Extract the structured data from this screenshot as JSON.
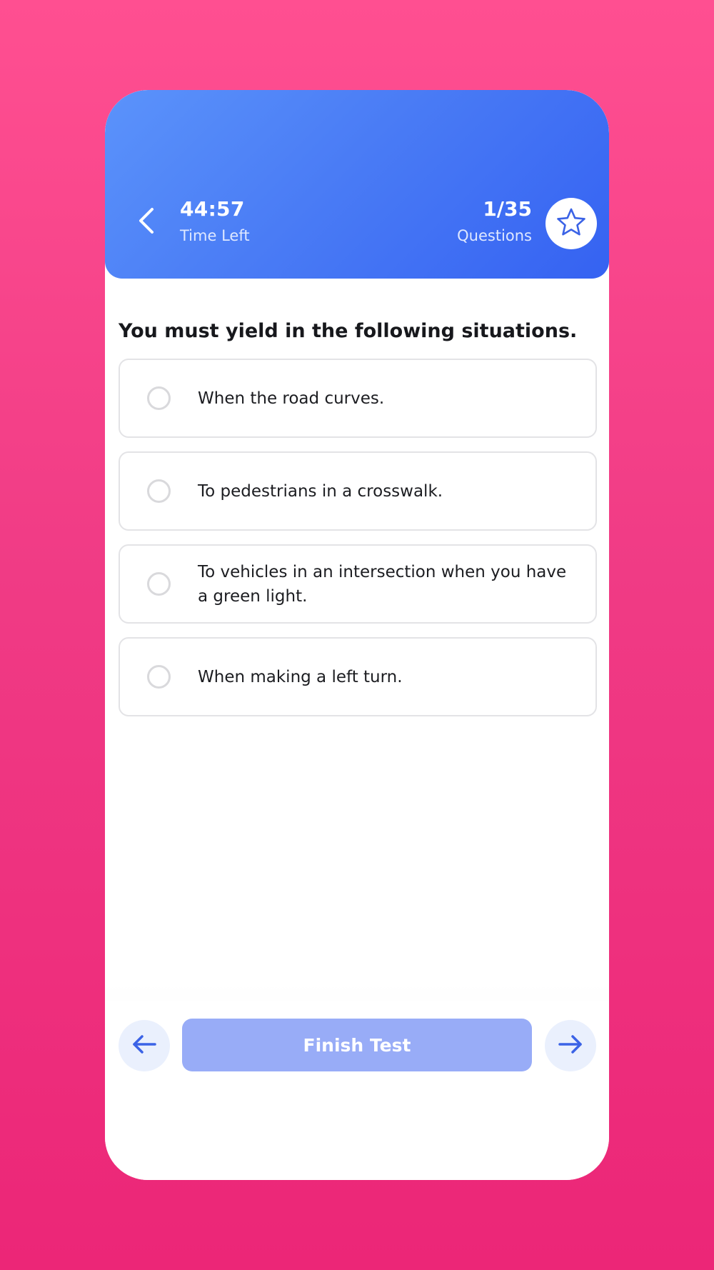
{
  "header": {
    "timer_value": "44:57",
    "timer_label": "Time Left",
    "progress_value": "1/35",
    "progress_label": "Questions"
  },
  "question": {
    "text": "You must yield in the following situations."
  },
  "options": [
    {
      "label": "When the road curves."
    },
    {
      "label": "To pedestrians in a crosswalk."
    },
    {
      "label": "To vehicles in an intersection when you have a green light."
    },
    {
      "label": "When making a left turn."
    }
  ],
  "footer": {
    "finish_label": "Finish Test"
  },
  "icons": {
    "back": "chevron-left-icon",
    "star": "star-icon",
    "prev": "arrow-left-icon",
    "next": "arrow-right-icon"
  },
  "colors": {
    "background": "#f03b85",
    "header_start": "#5b93fb",
    "header_end": "#3562f2",
    "finish_button": "#98acf7",
    "nav_button": "#eaf0fd",
    "accent_icon": "#3b63e6"
  }
}
